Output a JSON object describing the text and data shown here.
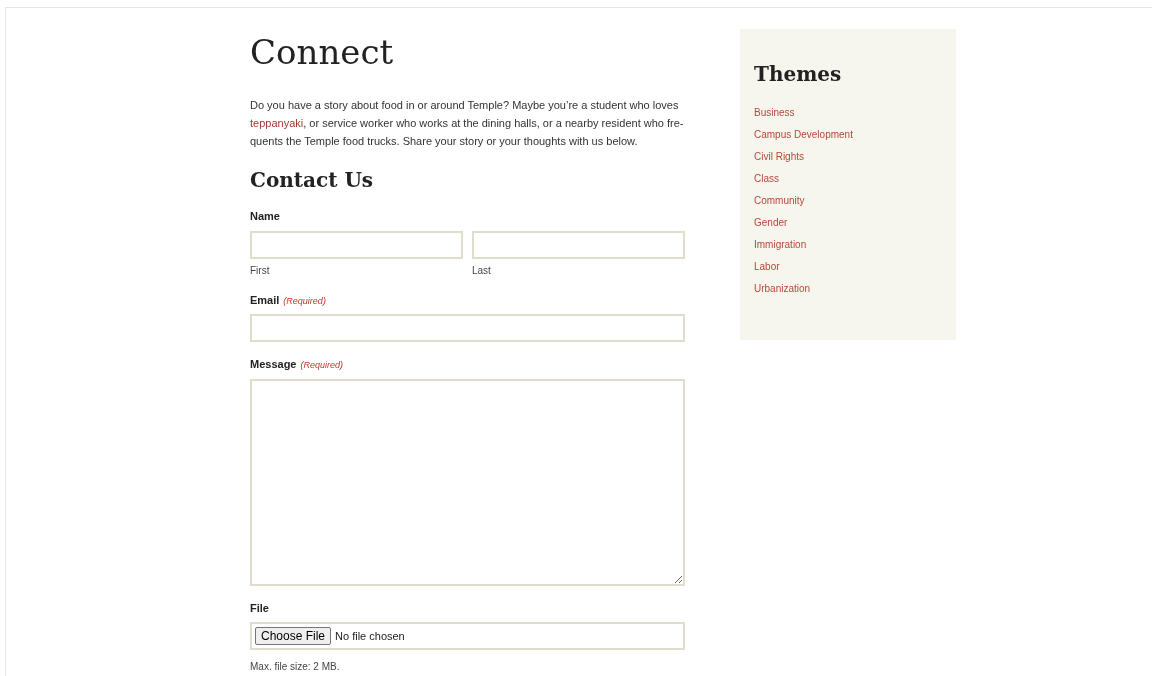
{
  "page_title": "Connect",
  "intro": [
    {
      "kind": "text",
      "text": "Do you have a story about food in or around Temple? Maybe you’re a student who loves "
    },
    {
      "kind": "link",
      "text": "teppanyaki"
    },
    {
      "kind": "text",
      "text": ", or service worker who works at the dining halls, or a nearby resident who fre-quents the Temple food trucks. Share your story or your thoughts with us below."
    }
  ],
  "form": {
    "title": "Contact Us",
    "name": {
      "label": "Name",
      "first": "First",
      "last": "Last"
    },
    "email": {
      "label": "Email",
      "required": "(Required)"
    },
    "message": {
      "label": "Message",
      "required": "(Required)"
    },
    "file": {
      "label": "File",
      "button": "Choose File",
      "status": "No file chosen",
      "note": "Max. file size: 2 MB."
    }
  },
  "sidebar": {
    "title": "Themes",
    "items": [
      "Business",
      "Campus Development",
      "Civil Rights",
      "Class",
      "Community",
      "Gender",
      "Immigration",
      "Labor",
      "Urbanization"
    ]
  }
}
